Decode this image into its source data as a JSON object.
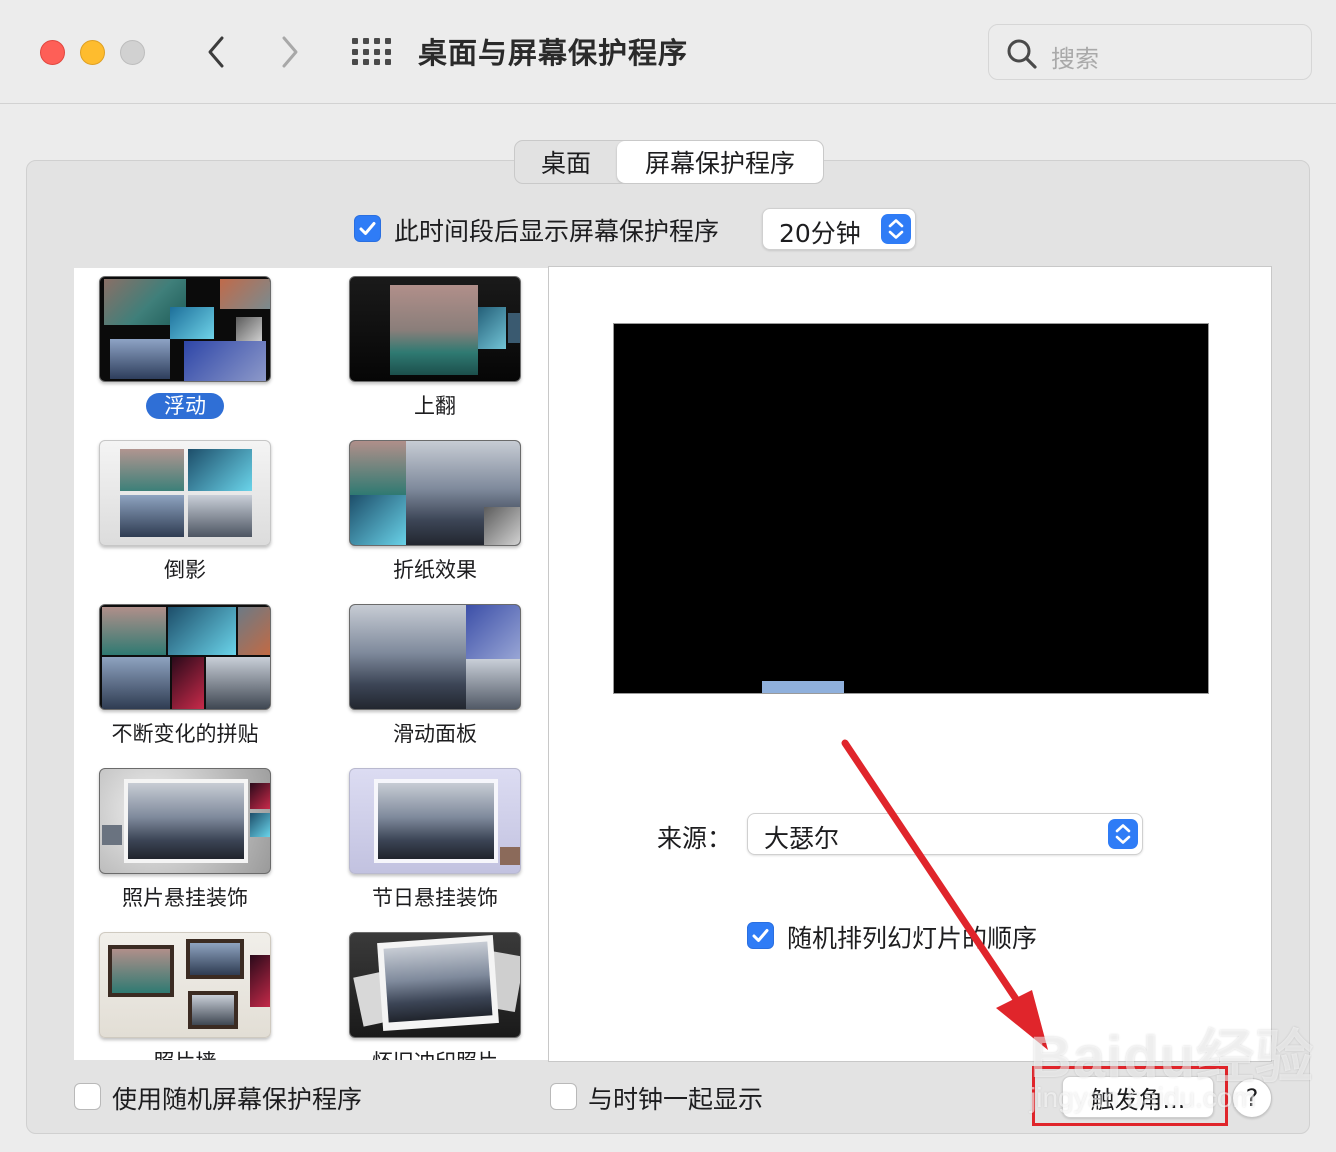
{
  "window": {
    "title": "桌面与屏幕保护程序",
    "search_placeholder": "搜索"
  },
  "tabs": [
    {
      "label": "桌面",
      "selected": false
    },
    {
      "label": "屏幕保护程序",
      "selected": true
    }
  ],
  "idle": {
    "checked": true,
    "label": "此时间段后显示屏幕保护程序",
    "duration": "20分钟"
  },
  "savers": [
    {
      "label": "浮动",
      "selected": true
    },
    {
      "label": "上翻",
      "selected": false
    },
    {
      "label": "倒影",
      "selected": false
    },
    {
      "label": "折纸效果",
      "selected": false
    },
    {
      "label": "不断变化的拼贴",
      "selected": false
    },
    {
      "label": "滑动面板",
      "selected": false
    },
    {
      "label": "照片悬挂装饰",
      "selected": false
    },
    {
      "label": "节日悬挂装饰",
      "selected": false
    },
    {
      "label": "照片墙",
      "selected": false
    },
    {
      "label": "怀旧冲印照片",
      "selected": false
    }
  ],
  "options": {
    "source_label": "来源：",
    "source_value": "大瑟尔",
    "shuffle_checked": true,
    "shuffle_label": "随机排列幻灯片的顺序"
  },
  "footer": {
    "random_checked": false,
    "random_label": "使用随机屏幕保护程序",
    "clock_checked": false,
    "clock_label": "与时钟一起显示",
    "hot_corners_label": "触发角...",
    "help_label": "?"
  },
  "watermark": {
    "brand": "Baidu经验",
    "url": "jingyan.baidu.com"
  },
  "colors": {
    "accent": "#2f7cf6",
    "annotation_red": "#e0252b"
  }
}
